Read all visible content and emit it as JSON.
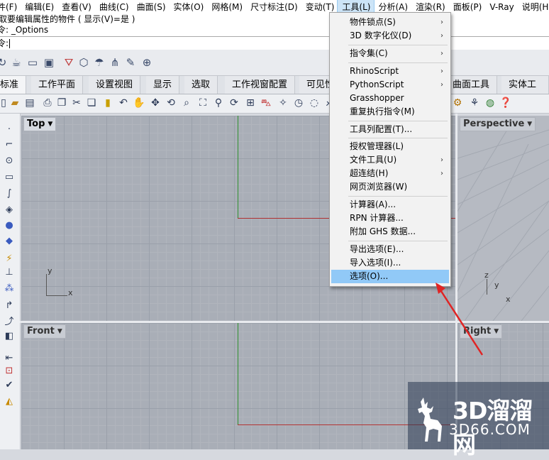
{
  "menubar": {
    "items": [
      "件(F)",
      "编辑(E)",
      "查看(V)",
      "曲线(C)",
      "曲面(S)",
      "实体(O)",
      "网格(M)",
      "尺寸标注(D)",
      "变动(T)",
      "工具(L)",
      "分析(A)",
      "渲染(R)",
      "面板(P)",
      "V-Ray",
      "说明(H)"
    ],
    "active_index": 9
  },
  "command": {
    "history_line": "取要编辑属性的物件 ( 显示(V)=是 )",
    "last_command": "令: _Options",
    "prompt": "令:"
  },
  "tabs": [
    "标准",
    "工作平面",
    "设置视图",
    "显示",
    "选取",
    "工作视窗配置",
    "可见性",
    "曲面工具",
    "实体工具"
  ],
  "viewports": {
    "top": "Top",
    "front": "Front",
    "perspective": "Perspective",
    "right": "Right"
  },
  "axis_labels": {
    "x": "x",
    "y": "y",
    "z": "z"
  },
  "tools_menu": {
    "items": [
      {
        "label": "物件锁点(S)",
        "submenu": true
      },
      {
        "label": "3D 数字化仪(D)",
        "submenu": true
      },
      {
        "label": "指令集(C)",
        "submenu": true
      },
      {
        "label": "RhinoScript",
        "submenu": true
      },
      {
        "label": "PythonScript",
        "submenu": true
      },
      {
        "label": "Grasshopper",
        "submenu": false
      },
      {
        "label": "重复执行指令(M)",
        "submenu": false
      },
      {
        "label": "工具列配置(T)...",
        "submenu": false
      },
      {
        "label": "授权管理器(L)",
        "submenu": false
      },
      {
        "label": "文件工具(U)",
        "submenu": true
      },
      {
        "label": "超连结(H)",
        "submenu": true
      },
      {
        "label": "网页浏览器(W)",
        "submenu": false
      },
      {
        "label": "计算器(A)...",
        "submenu": false
      },
      {
        "label": "RPN 计算器...",
        "submenu": false
      },
      {
        "label": "附加 GHS 数据...",
        "submenu": false
      },
      {
        "label": "导出选项(E)...",
        "submenu": false
      },
      {
        "label": "导入选项(I)...",
        "submenu": false
      },
      {
        "label": "选项(O)...",
        "submenu": false
      }
    ],
    "highlighted_index": 17
  },
  "watermark": {
    "line1": "3D溜溜网",
    "line2": "3D66.COM"
  },
  "colors": {
    "menu_highlight": "#91c9f7",
    "annotation_arrow": "#e02424",
    "axis_x": "#b03030",
    "axis_y": "#2f8f2f"
  }
}
